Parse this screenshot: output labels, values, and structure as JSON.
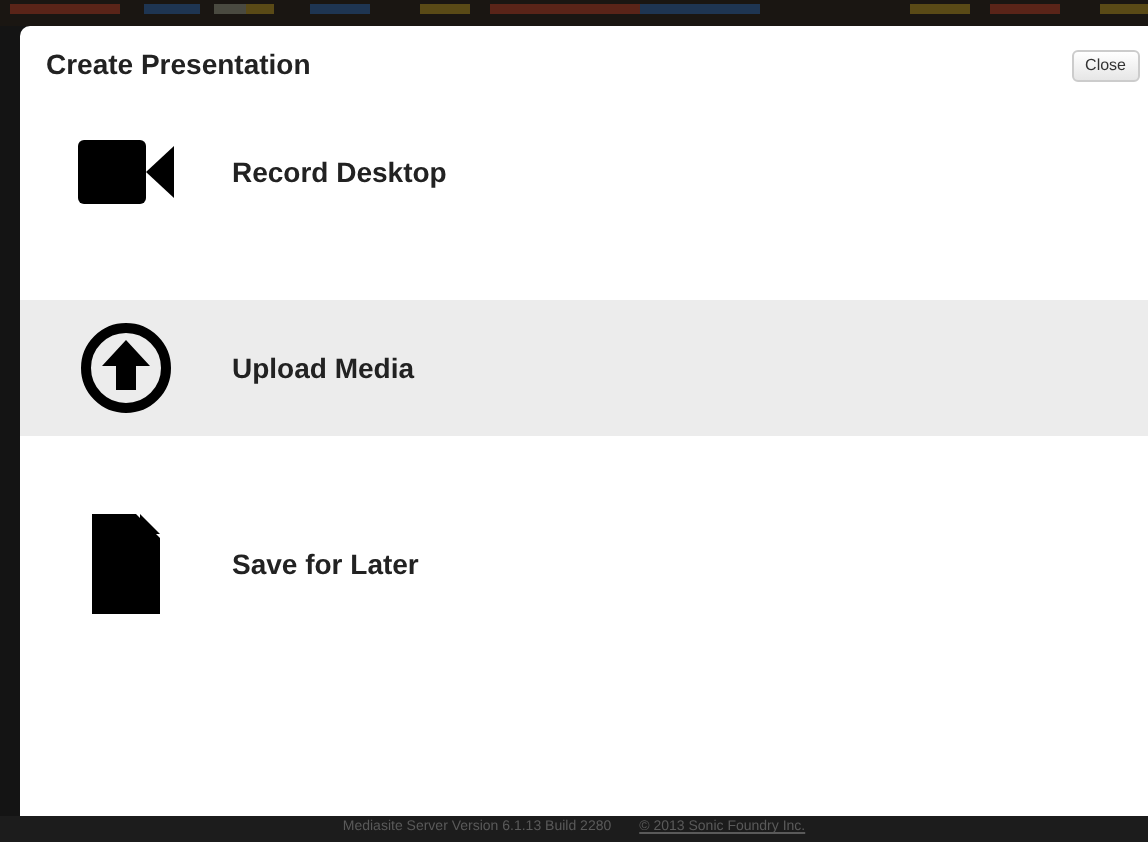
{
  "dialog": {
    "title": "Create Presentation",
    "close_button": "Close"
  },
  "options": [
    {
      "label": "Record Desktop",
      "kind": "camera",
      "selected": false
    },
    {
      "label": "Upload Media",
      "kind": "upload",
      "selected": true
    },
    {
      "label": "Save for Later",
      "kind": "file",
      "selected": false
    }
  ],
  "footer": {
    "version": "Mediasite Server Version 6.1.13 Build 2280",
    "copyright": "© 2013 Sonic Foundry Inc."
  }
}
